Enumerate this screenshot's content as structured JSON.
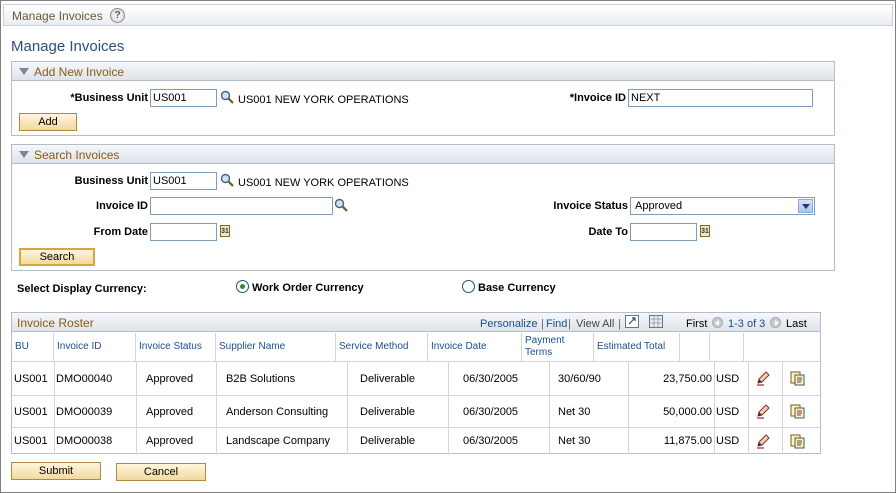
{
  "topbar": {
    "title": "Manage Invoices"
  },
  "page_title": "Manage Invoices",
  "add_section": {
    "title": "Add New Invoice",
    "business_unit_label": "*Business Unit",
    "business_unit_value": "US001",
    "business_unit_desc": "US001 NEW YORK OPERATIONS",
    "invoice_id_label": "*Invoice ID",
    "invoice_id_value": "NEXT",
    "add_button": "Add"
  },
  "search_section": {
    "title": "Search Invoices",
    "business_unit_label": "Business Unit",
    "business_unit_value": "US001",
    "business_unit_desc": "US001 NEW YORK OPERATIONS",
    "invoice_id_label": "Invoice ID",
    "invoice_id_value": "",
    "invoice_status_label": "Invoice Status",
    "invoice_status_value": "Approved",
    "from_date_label": "From Date",
    "from_date_value": "",
    "date_to_label": "Date To",
    "date_to_value": "",
    "search_button": "Search"
  },
  "currency": {
    "label": "Select Display Currency:",
    "option_work_order": "Work Order Currency",
    "option_base": "Base Currency",
    "selected": "Work Order Currency"
  },
  "roster": {
    "title": "Invoice Roster",
    "personalize": "Personalize",
    "find": "Find",
    "view_all": "View All",
    "separator": "|",
    "first": "First",
    "range": "1-3 of 3",
    "last": "Last",
    "columns": {
      "bu": "BU",
      "invoice_id": "Invoice ID",
      "invoice_status": "Invoice Status",
      "supplier_name": "Supplier Name",
      "service_method": "Service Method",
      "invoice_date": "Invoice Date",
      "payment_terms": "Payment Terms",
      "estimated_total": "Estimated Total"
    },
    "rows": [
      {
        "bu": "US001",
        "invoice_id": "DMO00040",
        "status": "Approved",
        "supplier": "B2B Solutions",
        "method": "Deliverable",
        "date": "06/30/2005",
        "terms": "30/60/90",
        "total": "23,750.00",
        "currency": "USD"
      },
      {
        "bu": "US001",
        "invoice_id": "DMO00039",
        "status": "Approved",
        "supplier": "Anderson Consulting",
        "method": "Deliverable",
        "date": "06/30/2005",
        "terms": "Net 30",
        "total": "50,000.00",
        "currency": "USD"
      },
      {
        "bu": "US001",
        "invoice_id": "DMO00038",
        "status": "Approved",
        "supplier": "Landscape Company",
        "method": "Deliverable",
        "date": "06/30/2005",
        "terms": "Net 30",
        "total": "11,875.00",
        "currency": "USD"
      }
    ]
  },
  "footer": {
    "submit": "Submit",
    "cancel": "Cancel"
  },
  "icons": {
    "help": "help-icon",
    "lookup": "magnifier-icon",
    "calendar": "calendar-icon",
    "edit": "pencil-icon",
    "detail": "document-icon"
  }
}
